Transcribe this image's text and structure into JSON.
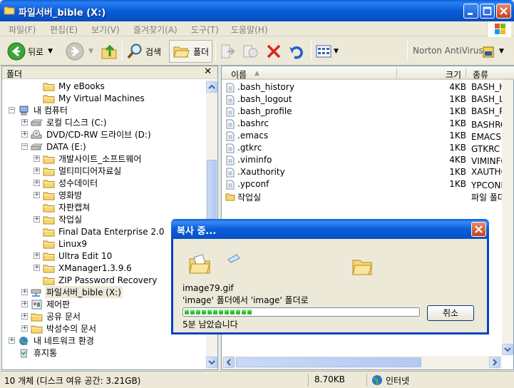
{
  "window": {
    "title": "파일서버_bible (X:)"
  },
  "menu": [
    "파일(F)",
    "편집(E)",
    "보기(V)",
    "즐겨찾기(A)",
    "도구(T)",
    "도움말(H)"
  ],
  "toolbar": {
    "back_label": "뒤로",
    "search_label": "검색",
    "folders_label": "폴더",
    "norton_label": "Norton AntiVirus"
  },
  "folder_pane": {
    "title": "폴더",
    "close_glyph": "✕",
    "items": [
      {
        "label": "My eBooks",
        "depth": 2,
        "expander": "",
        "icon": "folder-icon"
      },
      {
        "label": "My Virtual Machines",
        "depth": 2,
        "expander": "",
        "icon": "folder-icon"
      },
      {
        "label": "내 컴퓨터",
        "depth": 0,
        "expander": "−",
        "icon": "my-computer-icon"
      },
      {
        "label": "로컬 디스크 (C:)",
        "depth": 1,
        "expander": "+",
        "icon": "drive-icon"
      },
      {
        "label": "DVD/CD-RW 드라이브 (D:)",
        "depth": 1,
        "expander": "+",
        "icon": "cd-drive-icon"
      },
      {
        "label": "DATA (E:)",
        "depth": 1,
        "expander": "−",
        "icon": "drive-icon"
      },
      {
        "label": "개발사이트_소프트웨어",
        "depth": 2,
        "expander": "+",
        "icon": "folder-icon"
      },
      {
        "label": "멀티미디어자료실",
        "depth": 2,
        "expander": "+",
        "icon": "folder-icon"
      },
      {
        "label": "성수데이터",
        "depth": 2,
        "expander": "+",
        "icon": "folder-icon"
      },
      {
        "label": "영화방",
        "depth": 2,
        "expander": "+",
        "icon": "folder-icon"
      },
      {
        "label": "자판캡쳐",
        "depth": 2,
        "expander": "",
        "icon": "folder-icon"
      },
      {
        "label": "작업실",
        "depth": 2,
        "expander": "+",
        "icon": "folder-icon"
      },
      {
        "label": "Final Data Enterprise 2.0",
        "depth": 2,
        "expander": "",
        "icon": "folder-icon"
      },
      {
        "label": "Linux9",
        "depth": 2,
        "expander": "",
        "icon": "folder-icon"
      },
      {
        "label": "Ultra Edit 10",
        "depth": 2,
        "expander": "+",
        "icon": "folder-icon"
      },
      {
        "label": "XManager1.3.9.6",
        "depth": 2,
        "expander": "+",
        "icon": "folder-icon"
      },
      {
        "label": "ZIP Password Recovery",
        "depth": 2,
        "expander": "",
        "icon": "folder-icon"
      },
      {
        "label": "파일서버_bible (X:)",
        "depth": 1,
        "expander": "+",
        "icon": "network-drive-icon",
        "selected": true
      },
      {
        "label": "제어판",
        "depth": 1,
        "expander": "+",
        "icon": "control-panel-icon"
      },
      {
        "label": "공유 문서",
        "depth": 1,
        "expander": "+",
        "icon": "folder-icon"
      },
      {
        "label": "박성수의 문서",
        "depth": 1,
        "expander": "+",
        "icon": "folder-icon"
      },
      {
        "label": "내 네트워크 환경",
        "depth": 0,
        "expander": "+",
        "icon": "network-icon"
      },
      {
        "label": "휴지통",
        "depth": 0,
        "expander": "",
        "icon": "recycle-bin-icon"
      }
    ]
  },
  "file_pane": {
    "columns": {
      "name": "이름",
      "size": "크기",
      "type": "종류"
    },
    "files": [
      {
        "name": ".bash_history",
        "size": "4KB",
        "type": "BASH_HISTORY",
        "icon": "text-file-icon"
      },
      {
        "name": ".bash_logout",
        "size": "1KB",
        "type": "BASH_LOGOUT",
        "icon": "text-file-icon"
      },
      {
        "name": ".bash_profile",
        "size": "1KB",
        "type": "BASH_PROFILE",
        "icon": "text-file-icon"
      },
      {
        "name": ".bashrc",
        "size": "1KB",
        "type": "BASHRC 파일",
        "icon": "text-file-icon"
      },
      {
        "name": ".emacs",
        "size": "1KB",
        "type": "EMACS 파일",
        "icon": "text-file-icon"
      },
      {
        "name": ".gtkrc",
        "size": "1KB",
        "type": "GTKRC 파일",
        "icon": "text-file-icon"
      },
      {
        "name": ".viminfo",
        "size": "4KB",
        "type": "VIMINFO 파일",
        "icon": "text-file-icon"
      },
      {
        "name": ".Xauthority",
        "size": "1KB",
        "type": "XAUTHORITY",
        "icon": "text-file-icon"
      },
      {
        "name": ".ypconf",
        "size": "1KB",
        "type": "YPCONF 파일",
        "icon": "text-file-icon"
      },
      {
        "name": "작업실",
        "size": "",
        "type": "파일 폴더",
        "icon": "folder-icon"
      }
    ]
  },
  "status": {
    "objects": "10 개체 (디스크 여유 공간: 3.21GB)",
    "size": "8.70KB",
    "zone": "인터넷"
  },
  "copy_dialog": {
    "title": "복사 중...",
    "filename": "image79.gif",
    "from_to": "'image' 폴더에서 'image' 폴더로",
    "remaining": "5분 남았습니다",
    "cancel_label": "취소",
    "progress": 0.3
  }
}
